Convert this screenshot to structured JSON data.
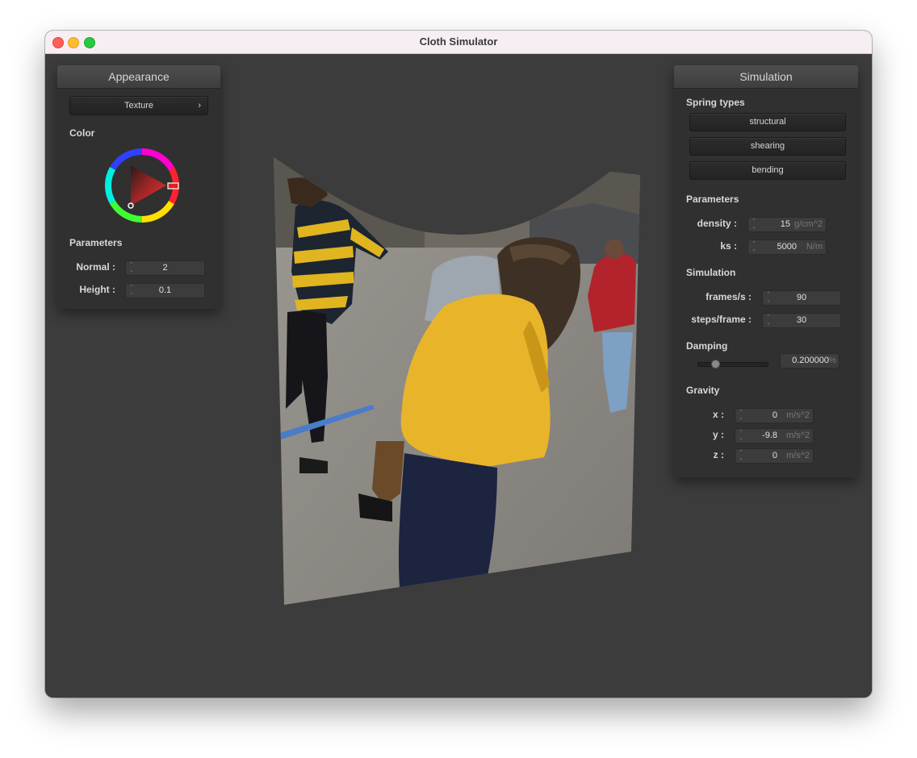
{
  "window": {
    "title": "Cloth Simulator"
  },
  "traffic_lights": {
    "close": "#fe5f57",
    "minimize": "#febc2e",
    "zoom": "#28c840"
  },
  "appearance": {
    "header": "Appearance",
    "texture_label": "Texture",
    "texture_arrow": "›",
    "color_label": "Color",
    "params_label": "Parameters",
    "normal": {
      "label": "Normal :",
      "value": "2"
    },
    "height": {
      "label": "Height :",
      "value": "0.1"
    }
  },
  "simulation": {
    "header": "Simulation",
    "spring_types_label": "Spring types",
    "spring_buttons": [
      "structural",
      "shearing",
      "bending"
    ],
    "params_label": "Parameters",
    "density": {
      "label": "density :",
      "value": "15",
      "unit": "g/cm^2"
    },
    "ks": {
      "label": "ks :",
      "value": "5000",
      "unit": "N/m"
    },
    "sim_label": "Simulation",
    "fps": {
      "label": "frames/s :",
      "value": "90"
    },
    "steps": {
      "label": "steps/frame :",
      "value": "30"
    },
    "damping_label": "Damping",
    "damping": {
      "value": "0.200000",
      "unit": "%",
      "level": 0.2
    },
    "gravity_label": "Gravity",
    "gx": {
      "label": "x :",
      "value": "0",
      "unit": "m/s^2"
    },
    "gy": {
      "label": "y :",
      "value": "-9.8",
      "unit": "m/s^2"
    },
    "gz": {
      "label": "z :",
      "value": "0",
      "unit": "m/s^2"
    }
  }
}
